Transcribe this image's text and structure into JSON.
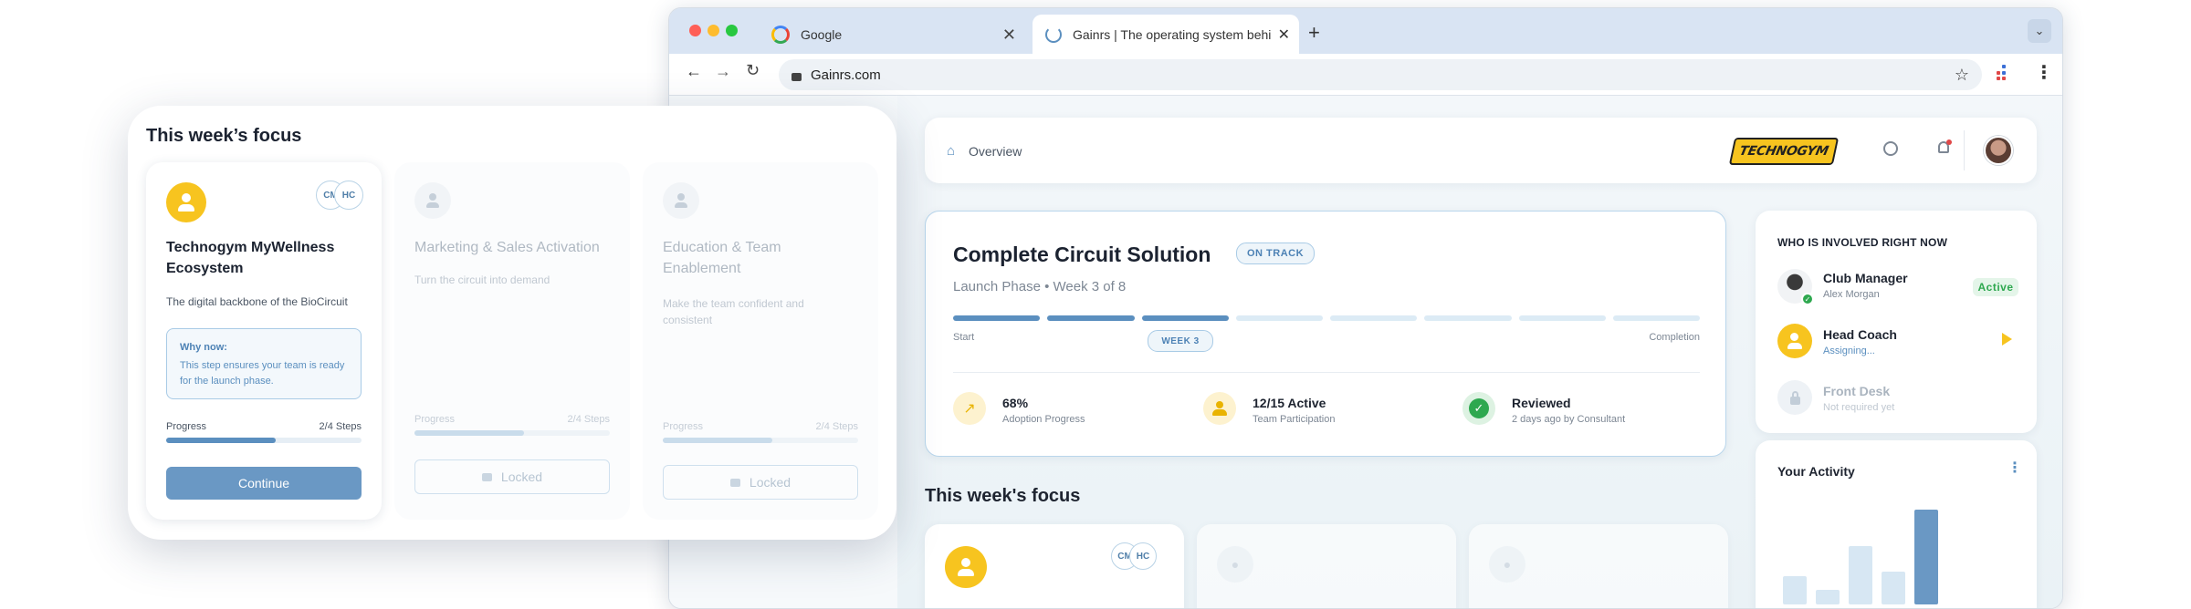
{
  "browser": {
    "tabs": [
      {
        "title": "Google"
      },
      {
        "title": "Gainrs | The operating system behi"
      }
    ],
    "url": "Gainrs.com"
  },
  "header": {
    "breadcrumb": "Overview",
    "brand_logo_text": "TECHNOGYM"
  },
  "project": {
    "title": "Complete Circuit Solution",
    "status": "ON TRACK",
    "subtitle": "Launch Phase • Week 3 of 8",
    "timeline": {
      "total_weeks": 8,
      "completed_weeks": 3,
      "start_label": "Start",
      "end_label": "Completion",
      "current_label": "WEEK 3"
    },
    "stats": [
      {
        "value": "68%",
        "label": "Adoption Progress",
        "icon": "trend-up-icon"
      },
      {
        "value": "12/15 Active",
        "label": "Team Participation",
        "icon": "team-icon"
      },
      {
        "value": "Reviewed",
        "label": "2 days ago by Consultant",
        "icon": "check-circle-icon"
      }
    ]
  },
  "involved": {
    "title": "WHO IS INVOLVED RIGHT NOW",
    "people": [
      {
        "role": "Club Manager",
        "detail": "Alex Morgan",
        "status": "Active"
      },
      {
        "role": "Head Coach",
        "detail": "Assigning..."
      },
      {
        "role": "Front Desk",
        "detail": "Not required yet"
      }
    ]
  },
  "activity": {
    "title": "Your Activity",
    "bars": [
      0.3,
      0.15,
      0.62,
      0.35,
      1.0
    ]
  },
  "focus_section_title": "This week's focus",
  "focus_overlay": {
    "title": "This week’s focus",
    "cards": [
      {
        "title": "Technogym MyWellness Ecosystem",
        "desc": "The digital backbone of the BioCircuit",
        "why_title": "Why now:",
        "why_text": "This step ensures your team is ready for the launch phase.",
        "progress_label": "Progress",
        "steps": "2/4 Steps",
        "progress": 0.56,
        "button": "Continue",
        "avatars": [
          "CM",
          "HC"
        ]
      },
      {
        "title": "Marketing & Sales Activation",
        "desc": "Turn the circuit into demand",
        "progress_label": "Progress",
        "steps": "2/4 Steps",
        "progress": 0.56,
        "button": "Locked"
      },
      {
        "title": "Education & Team Enablement",
        "desc": "Make the team confident and consistent",
        "progress_label": "Progress",
        "steps": "2/4 Steps",
        "progress": 0.56,
        "button": "Locked"
      }
    ]
  },
  "bg_focus_avatars": [
    "CM",
    "HC"
  ],
  "colors": {
    "accent": "#5b8fbf",
    "yellow": "#f7c41f",
    "active_green": "#2ea84f",
    "track": "#dcebf5"
  }
}
